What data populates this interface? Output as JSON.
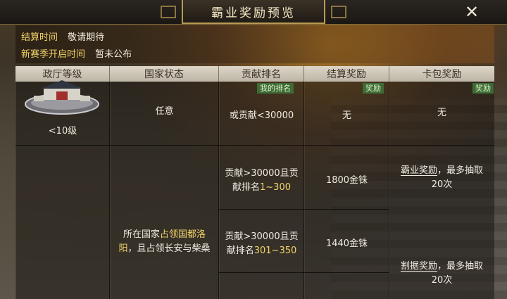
{
  "dialog": {
    "title": "霸业奖励预览",
    "close_label": "✕"
  },
  "info": {
    "settlement_label": "结算时间",
    "settlement_value": "敬请期待",
    "season_label": "新赛季开启时间",
    "season_value": "暂未公布"
  },
  "table": {
    "headers": [
      "政厅等级",
      "国家状态",
      "贡献排名",
      "结算奖励",
      "卡包奖励"
    ],
    "tags": {
      "my_rank": "我的排名",
      "reward": "奖励",
      "card_reward": "奖励"
    },
    "row1": {
      "hall_level": "<10级",
      "state": "任意",
      "rank": "或贡献<30000",
      "settlement": "无",
      "card": "无"
    },
    "row2": {
      "state_pre": "所在国家",
      "state_hl": "占领国都洛阳",
      "state_post": "，且占领长安与柴桑",
      "rank_a_pre": "贡献>30000且贡献排名",
      "rank_a_hl": "1~300",
      "settlement_a": "1800金铢",
      "card_a_link": "霸业奖励",
      "card_a_post": "，最多抽取20次",
      "rank_b_pre": "贡献>30000且贡献排名",
      "rank_b_hl": "301~350",
      "settlement_b": "1440金铢",
      "card_b_link": "割据奖励",
      "card_b_post": "，最多抽取20次"
    }
  },
  "colors": {
    "highlight": "#f2d36b",
    "tag_green": "#3d6b36",
    "title_gold": "#b99a55"
  }
}
